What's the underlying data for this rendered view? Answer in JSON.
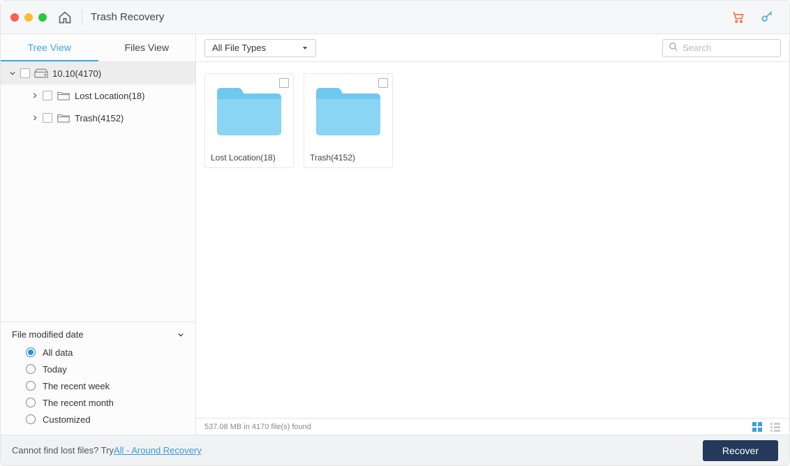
{
  "titlebar": {
    "title": "Trash Recovery"
  },
  "sidebar": {
    "tabs": {
      "tree": "Tree View",
      "files": "Files View"
    },
    "tree": {
      "root": "10.10(4170)",
      "children": [
        {
          "label": "Lost Location(18)"
        },
        {
          "label": "Trash(4152)"
        }
      ]
    },
    "filter": {
      "heading": "File modified date",
      "options": [
        "All data",
        "Today",
        "The recent week",
        "The recent month",
        "Customized"
      ],
      "selected": "All data"
    }
  },
  "toolbar": {
    "filetype_dropdown": "All File Types",
    "search_placeholder": "Search"
  },
  "grid": {
    "items": [
      {
        "label": "Lost Location(18)"
      },
      {
        "label": "Trash(4152)"
      }
    ]
  },
  "status": {
    "text": "537.08 MB in 4170 file(s) found"
  },
  "footer": {
    "prompt": "Cannot find lost files? Try ",
    "link": "All - Around Recovery",
    "recover": "Recover"
  }
}
